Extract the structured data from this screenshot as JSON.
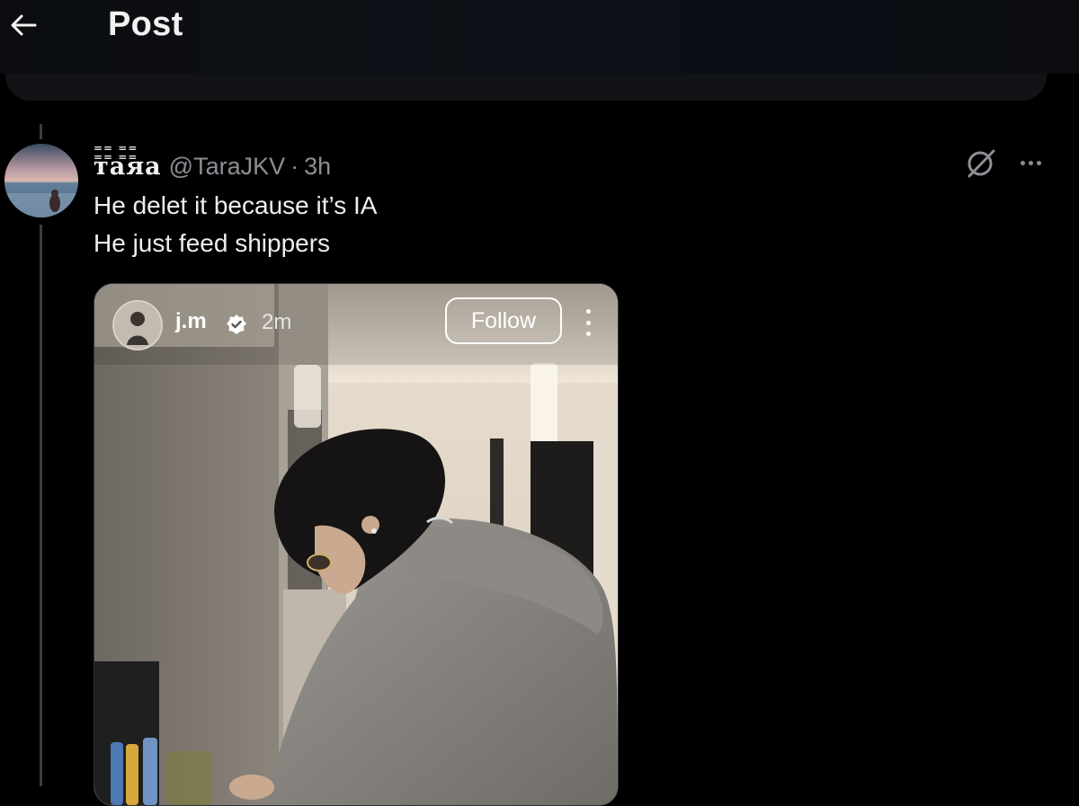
{
  "header": {
    "title": "Post",
    "back_icon": "arrow-left-icon"
  },
  "tweet": {
    "display_name": "тaяa",
    "handle": "@TaraJKV",
    "separator": "·",
    "time": "3h",
    "text_lines": [
      "He delet it because it’s IA",
      "He just feed shippers"
    ],
    "grok_icon": "grok-icon",
    "more_icon": "more-dots-icon"
  },
  "embedded_post": {
    "username": "j.m",
    "verified_icon": "verified-badge-icon",
    "time": "2m",
    "follow_label": "Follow",
    "more_icon": "vertical-dots-icon"
  },
  "colors": {
    "background": "#000000",
    "secondary_text": "#8b8f94",
    "primary_text": "#e7e9ea"
  }
}
